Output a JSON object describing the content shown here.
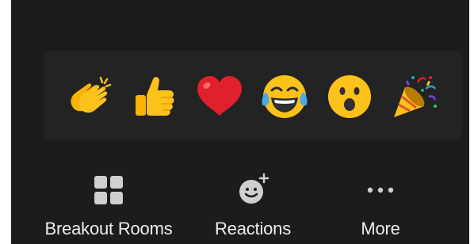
{
  "reactions": {
    "items": [
      {
        "name": "clapping-hands",
        "icon": "clap-icon"
      },
      {
        "name": "thumbs-up",
        "icon": "thumbs-up-icon"
      },
      {
        "name": "red-heart",
        "icon": "heart-icon"
      },
      {
        "name": "tears-of-joy",
        "icon": "tears-of-joy-icon"
      },
      {
        "name": "open-mouth",
        "icon": "surprised-icon"
      },
      {
        "name": "party-popper",
        "icon": "party-popper-icon"
      }
    ]
  },
  "toolbar": {
    "breakout_label": "Breakout Rooms",
    "reactions_label": "Reactions",
    "more_label": "More"
  },
  "colors": {
    "background": "#1c1c1c",
    "panel": "#232323",
    "label": "#ededed",
    "icon": "#cfcfcf",
    "emoji_yellow": "#fcc21b",
    "heart_red": "#e0202a"
  }
}
